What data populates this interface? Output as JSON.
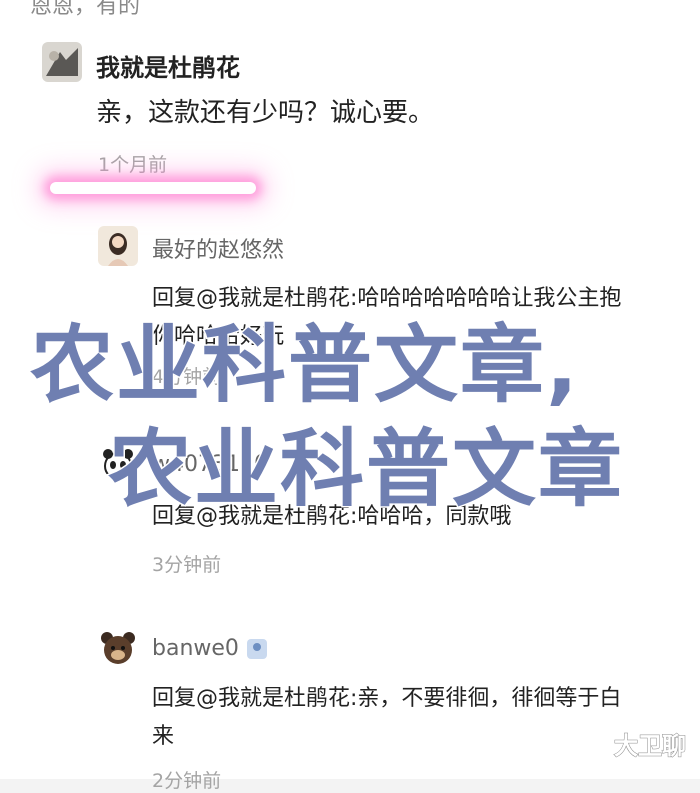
{
  "top_fragment": "恩恩，有的",
  "main_comment": {
    "user": "我就是杜鹃花",
    "text": "亲，这款还有少吗？诚心要。",
    "time": "1个月前"
  },
  "replies": [
    {
      "user": "最好的赵悠然",
      "text": "回复@我就是杜鹃花:哈哈哈哈哈哈哈让我公主抱你哈哈哈好玩",
      "time": "4分钟前"
    },
    {
      "user": "w4073120",
      "text": "回复@我就是杜鹃花:哈哈哈，同款哦",
      "time": "3分钟前"
    },
    {
      "user": "banwe0",
      "text": "回复@我就是杜鹃花:亲，不要徘徊，徘徊等于白来",
      "time": "2分钟前"
    }
  ],
  "overlay": {
    "line1": "农业科普文章,",
    "line2": "农业科普文章"
  },
  "watermark": "大卫聊",
  "colors": {
    "overlay_text": "#6f7fb1",
    "glow": "#ff69c8",
    "time_text": "#a4a4a4"
  }
}
